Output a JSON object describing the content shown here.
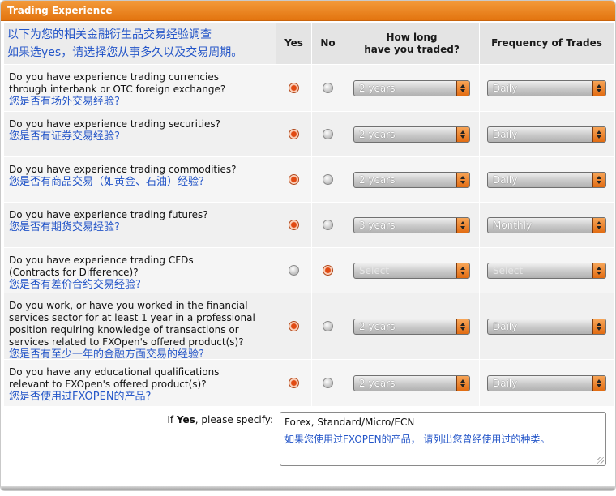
{
  "panel": {
    "title": "Trading Experience"
  },
  "header": {
    "cn_line1": "以下为您的相关金融衍生品交易经验调查",
    "cn_line2": "如果选yes，请选择您从事多久以及交易周期。",
    "col_yes": "Yes",
    "col_no": "No",
    "col_how_line1": "How long",
    "col_how_line2": "have you traded?",
    "col_freq": "Frequency of Trades"
  },
  "questions": [
    {
      "lines": [
        "Do you have experience trading currencies",
        "through interbank or OTC foreign exchange?"
      ],
      "cn": "您是否有场外交易经验?",
      "answer": "yes",
      "how_long": "2 years",
      "frequency": "Daily",
      "disabled": false
    },
    {
      "lines": [
        "Do you have experience trading securities?"
      ],
      "cn": "您是否有证券交易经验?",
      "answer": "yes",
      "how_long": "2 years",
      "frequency": "Daily",
      "disabled": false
    },
    {
      "lines": [
        "Do you have experience trading commodities?"
      ],
      "cn": "您是否有商品交易（如黄金、石油）经验?",
      "answer": "yes",
      "how_long": "2 years",
      "frequency": "Daily",
      "disabled": false
    },
    {
      "lines": [
        "Do you have experience trading futures?"
      ],
      "cn": "您是否有期货交易经验?",
      "answer": "yes",
      "how_long": "3 years",
      "frequency": "Monthly",
      "disabled": false
    },
    {
      "lines": [
        "Do you have experience trading CFDs",
        "(Contracts for Difference)?"
      ],
      "cn": "您是否有差价合约交易经验?",
      "answer": "no",
      "how_long": "Select",
      "frequency": "Select",
      "disabled": true
    },
    {
      "lines": [
        "Do you work, or have you worked in the financial",
        "services sector for at least 1 year in a professional",
        "position requiring knowledge of transactions or",
        "services related to FXOpen's offered product(s)?"
      ],
      "cn": "您是否有至少一年的金融方面交易的经验?",
      "answer": "yes",
      "how_long": "2 years",
      "frequency": "Daily",
      "disabled": false
    },
    {
      "lines": [
        "Do you have any educational qualifications",
        "relevant to FXOpen's offered product(s)?"
      ],
      "cn": "您是否使用过FXOPEN的产品?",
      "answer": "yes",
      "how_long": "2 years",
      "frequency": "Daily",
      "disabled": false
    }
  ],
  "specify": {
    "label_prefix": "If ",
    "label_bold": "Yes",
    "label_suffix": ", please specify:",
    "value": "Forex, Standard/Micro/ECN",
    "cn_note": "如果您使用过FXOPEN的产品，  请列出您曾经使用过的种类。"
  }
}
